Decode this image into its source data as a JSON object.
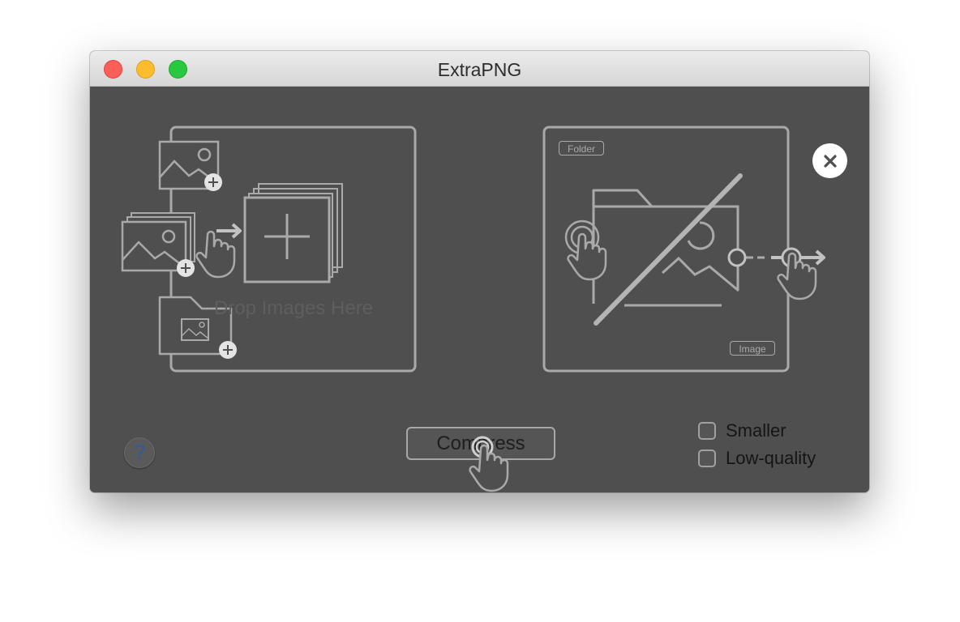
{
  "window": {
    "title": "ExtraPNG",
    "controls": [
      "close",
      "minimize",
      "zoom"
    ]
  },
  "drop_zone": {
    "label": "Drop Images Here"
  },
  "output_panel": {
    "folder_tag": "Folder",
    "image_tag": "Image"
  },
  "buttons": {
    "close_symbol": "✕",
    "help_symbol": "?",
    "compress_label": "Compress"
  },
  "options": {
    "smaller_label": "Smaller",
    "low_quality_label": "Low-quality"
  },
  "icons": [
    "image-plus-icon",
    "images-stack-plus-icon",
    "folder-image-plus-icon",
    "add-stack-icon",
    "hand-pointer-icon",
    "folder-icon",
    "image-icon",
    "arrow-right-icon"
  ],
  "colors": {
    "background": "#4f4f4f",
    "line_art": "#a9a9a9",
    "close_red": "#fc5f57",
    "minimize_yellow": "#fdbc2e",
    "zoom_green": "#28c840",
    "help_blue": "#2d5aa8"
  }
}
